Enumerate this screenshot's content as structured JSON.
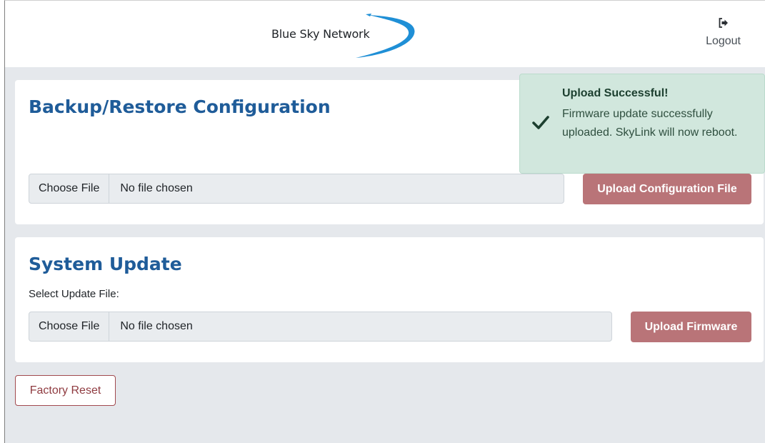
{
  "header": {
    "logo_text": "Blue Sky Network",
    "logout_icon": "logout-icon",
    "logout_label": "Logout"
  },
  "backup": {
    "title": "Backup/Restore Configuration",
    "choose_file_label": "Choose File",
    "file_status": "No file chosen",
    "upload_label": "Upload Configuration File"
  },
  "system_update": {
    "title": "System Update",
    "select_label": "Select Update File:",
    "choose_file_label": "Choose File",
    "file_status": "No file chosen",
    "upload_label": "Upload Firmware"
  },
  "factory_reset_label": "Factory Reset",
  "toast": {
    "icon": "checkmark-icon",
    "title": "Upload Successful!",
    "message": "Firmware update successfully uploaded. SkyLink will now reboot."
  },
  "colors": {
    "title_blue": "#1f5c99",
    "upload_button": "#b97478",
    "reset_border": "#a24a4f",
    "toast_bg": "#d1e7dd",
    "page_bg": "#e5e8ec"
  }
}
